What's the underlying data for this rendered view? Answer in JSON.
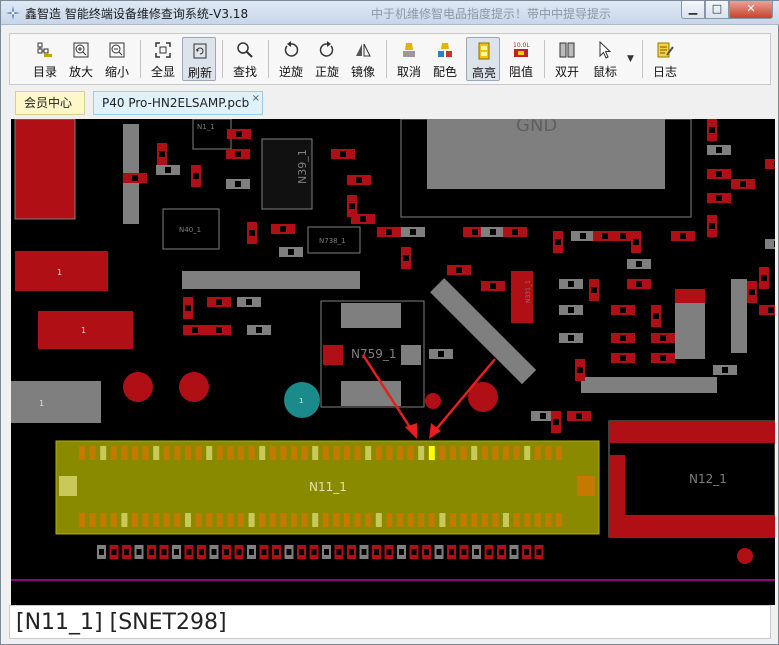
{
  "window": {
    "title": "鑫智造 智能终端设备维修查询系统-V3.18",
    "ghost_title": "中于机维修智电品指度提示！带中中提导提示",
    "buttons": {
      "minimize": "▁",
      "maximize": "□",
      "close": "✕"
    }
  },
  "toolbar": [
    {
      "label": "目录",
      "icon": "catalog-icon"
    },
    {
      "label": "放大",
      "icon": "zoom-in-icon"
    },
    {
      "label": "缩小",
      "icon": "zoom-out-icon"
    },
    {
      "label": "全显",
      "icon": "fit-all-icon"
    },
    {
      "label": "刷新",
      "icon": "refresh-icon"
    },
    {
      "label": "查找",
      "icon": "search-icon"
    },
    {
      "label": "逆旋",
      "icon": "rotate-ccw-icon"
    },
    {
      "label": "正旋",
      "icon": "rotate-cw-icon"
    },
    {
      "label": "镜像",
      "icon": "mirror-icon"
    },
    {
      "label": "取消",
      "icon": "clear-highlight-icon"
    },
    {
      "label": "配色",
      "icon": "color-scheme-icon"
    },
    {
      "label": "高亮",
      "icon": "highlight-icon"
    },
    {
      "label": "阻值",
      "icon": "resistance-icon"
    },
    {
      "label": "双开",
      "icon": "dual-open-icon"
    },
    {
      "label": "鼠标",
      "icon": "mouse-cursor-icon"
    },
    {
      "label": "日志",
      "icon": "log-icon"
    }
  ],
  "tabs": {
    "member": "会员中心",
    "pcb": "P40 Pro-HN2ELSAMP.pcb",
    "close": "×"
  },
  "board": {
    "labels": {
      "gnd": "GND",
      "n39": "N39_1",
      "n40": "N40_1",
      "n759": "N759_1",
      "n11": "N11_1",
      "n12": "N12_1",
      "small_n": "N1_1",
      "n738": "N738_1",
      "n331": "N331_1",
      "pad_one": "1"
    },
    "colors": {
      "background": "#000000",
      "pad_red": "#b01015",
      "pad_gray": "#7f7f7f",
      "connector_olive": "#8a8a00",
      "connector_pin": "#c47a00",
      "highlight_pin": "#ffff00",
      "teal_via": "#1a8a8a",
      "arrow": "#e62020",
      "trace": "#b00fb0"
    }
  },
  "status": {
    "text": "[N11_1] [SNET298]"
  }
}
